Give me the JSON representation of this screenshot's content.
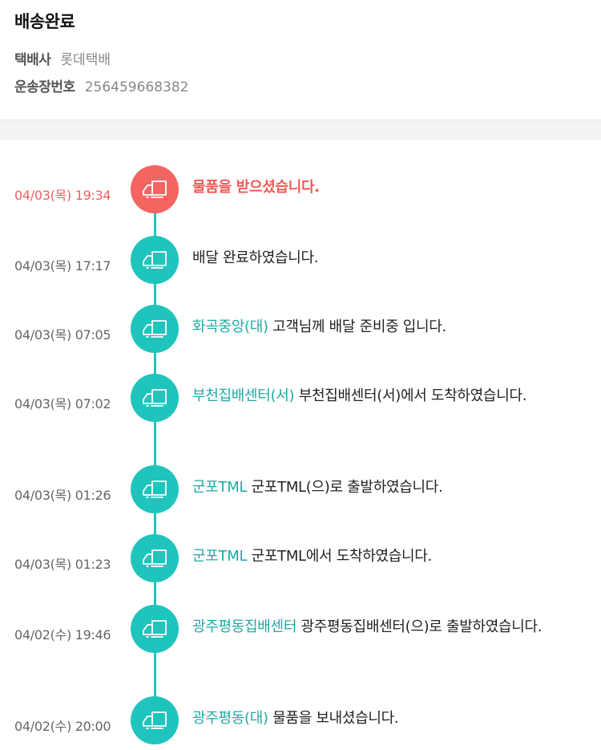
{
  "header": {
    "status_title": "배송완료",
    "carrier_label": "택배사",
    "carrier_value": "롯데택배",
    "tracking_label": "운송장번호",
    "tracking_value": "256459668382"
  },
  "colors": {
    "accent": "#1fc4bd",
    "location_text": "#1fa9a3",
    "current": "#f46460"
  },
  "icon": "delivery-truck-icon",
  "events": [
    {
      "time": "04/03(목) 19:34",
      "location": "",
      "message": "물품을 받으셨습니다.",
      "current": true
    },
    {
      "time": "04/03(목) 17:17",
      "location": "",
      "message": "배달 완료하였습니다."
    },
    {
      "time": "04/03(목) 07:05",
      "location": "화곡중앙(대)",
      "message": "고객님께 배달 준비중 입니다."
    },
    {
      "time": "04/03(목) 07:02",
      "location": "부천집배센터(서)",
      "message": "부천집배센터(서)에서 도착하였습니다."
    },
    {
      "time": "04/03(목) 01:26",
      "location": "군포TML",
      "message": "군포TML(으)로 출발하였습니다."
    },
    {
      "time": "04/03(목) 01:23",
      "location": "군포TML",
      "message": "군포TML에서 도착하였습니다."
    },
    {
      "time": "04/02(수) 19:46",
      "location": "광주평동집배센터",
      "message": "광주평동집배센터(으)로 출발하였습니다."
    },
    {
      "time": "04/02(수) 20:00",
      "location": "광주평동(대)",
      "message": "물품을 보내셨습니다."
    }
  ]
}
